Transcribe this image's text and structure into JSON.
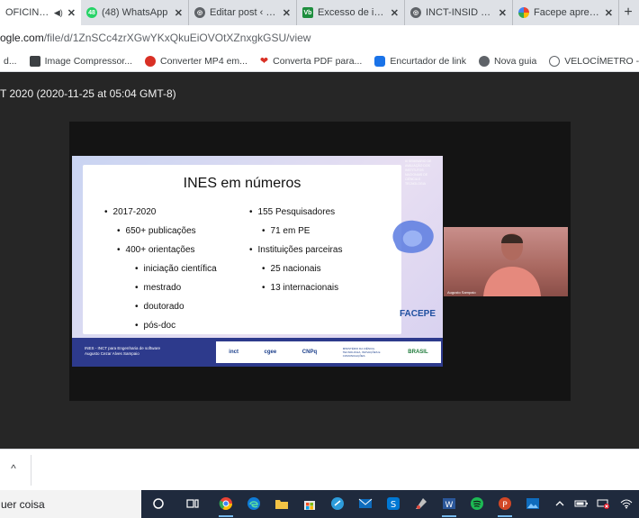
{
  "browser": {
    "tabs": [
      {
        "title": "OFICINA VII",
        "favicon": "drive-icon",
        "active": true
      },
      {
        "title": "(48) WhatsApp",
        "favicon": "whatsapp-icon",
        "active": false
      },
      {
        "title": "Editar post ‹ FAC",
        "favicon": "globe-icon",
        "active": false
      },
      {
        "title": "Excesso de infor",
        "favicon": "vb-icon",
        "active": false
      },
      {
        "title": "INCT-INSID – In",
        "favicon": "globe-icon",
        "active": false
      },
      {
        "title": "Facepe apresen",
        "favicon": "google-icon",
        "active": false
      }
    ],
    "new_tab_symbol": "+",
    "close_symbol": "✕",
    "url_host": "ogle.com",
    "url_path": "/file/d/1ZnSCc4zrXGwYKxQkuEiOVOtXZnxgkGSU/view",
    "bookmarks": [
      {
        "label": "d...",
        "icon": "bookmark-icon"
      },
      {
        "label": "Image Compressor...",
        "icon": "image-icon"
      },
      {
        "label": "Converter MP4 em...",
        "icon": "convert-icon"
      },
      {
        "label": "Converta PDF para...",
        "icon": "heart-icon"
      },
      {
        "label": "Encurtador de link",
        "icon": "link-icon"
      },
      {
        "label": "Nova guia",
        "icon": "globe-icon"
      },
      {
        "label": "VELOCÍMETRO - Te...",
        "icon": "speedometer-icon"
      }
    ]
  },
  "viewer": {
    "title": "T 2020 (2020-11-25 at 05:04 GMT-8)",
    "slide": {
      "heading": "INES em números",
      "left_list": [
        {
          "level": 1,
          "text": "2017-2020"
        },
        {
          "level": 2,
          "text": "650+ publicações"
        },
        {
          "level": 2,
          "text": "400+ orientações"
        },
        {
          "level": 3,
          "text": "iniciação científica"
        },
        {
          "level": 3,
          "text": "mestrado"
        },
        {
          "level": 3,
          "text": "doutorado"
        },
        {
          "level": 3,
          "text": "pós-doc"
        }
      ],
      "right_list": [
        {
          "level": 1,
          "text": "155 Pesquisadores"
        },
        {
          "level": 2,
          "text": "71 em PE"
        },
        {
          "level": 1,
          "text": "Instituições parceiras"
        },
        {
          "level": 2,
          "text": "25 nacionais"
        },
        {
          "level": 2,
          "text": "13 internacionais"
        }
      ],
      "side_note": "III SEMINÁRIO DE AVALIAÇÃO DOS INSTITUTOS NACIONAIS DE CIÊNCIA E TECNOLOGIA",
      "corner_logo": "FACEPE",
      "footer_line1": "INES - INCT para Engenharia de software",
      "footer_line2": "Augusto Cezar Alves Sampaio",
      "footer_logos": [
        "inct",
        "cgee",
        "CNPq",
        "MINISTÉRIO DA CIÊNCIA, TECNOLOGIA, INOVAÇÕES E COMUNICAÇÕES",
        "BRASIL"
      ]
    },
    "webcam_name": "Augusto Sampaio"
  },
  "bottom_bar": {
    "chevron": "^"
  },
  "taskbar": {
    "search_text": "uer coisa",
    "icons": [
      "cortana-icon",
      "task-view-icon",
      "chrome-icon",
      "edge-icon",
      "file-explorer-icon",
      "store-icon",
      "skype-icon",
      "mail-icon",
      "skype-business-icon",
      "paint-icon",
      "word-icon",
      "spotify-icon",
      "powerpoint-icon",
      "photos-icon"
    ],
    "tray": [
      "chevron-up-icon",
      "battery-icon",
      "network-icon",
      "wifi-icon"
    ]
  }
}
